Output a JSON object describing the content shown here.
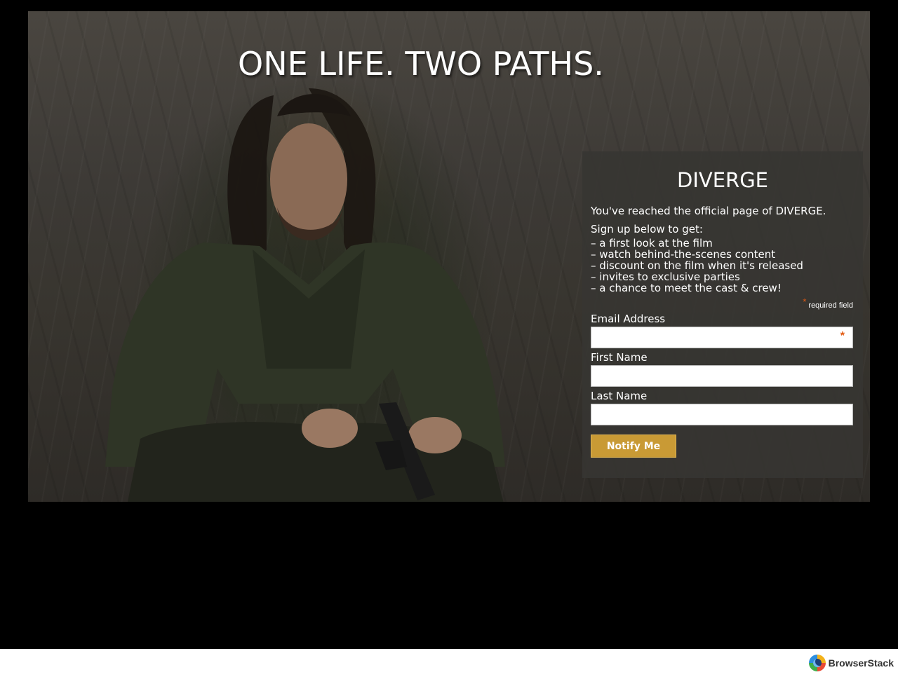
{
  "hero": {
    "headline": "ONE LIFE. TWO PATHS."
  },
  "panel": {
    "title": "DIVERGE",
    "intro": "You've reached the official page of DIVERGE.",
    "signup_heading": "Sign up below to get:",
    "perks": [
      "a first look at the film",
      "watch behind-the-scenes content",
      "discount on the film when it's released",
      "invites to exclusive parties",
      "a chance to meet the cast & crew!"
    ],
    "required_note": "required field",
    "required_mark": "*",
    "fields": {
      "email": {
        "label": "Email Address",
        "value": ""
      },
      "first_name": {
        "label": "First Name",
        "value": ""
      },
      "last_name": {
        "label": "Last Name",
        "value": ""
      }
    },
    "submit_label": "Notify Me"
  },
  "footer": {
    "brand": "BrowserStack"
  },
  "colors": {
    "accent_button": "#c99a35",
    "required_star": "#e25a12"
  },
  "icons": {
    "browserstack": "browserstack-logo-icon"
  }
}
